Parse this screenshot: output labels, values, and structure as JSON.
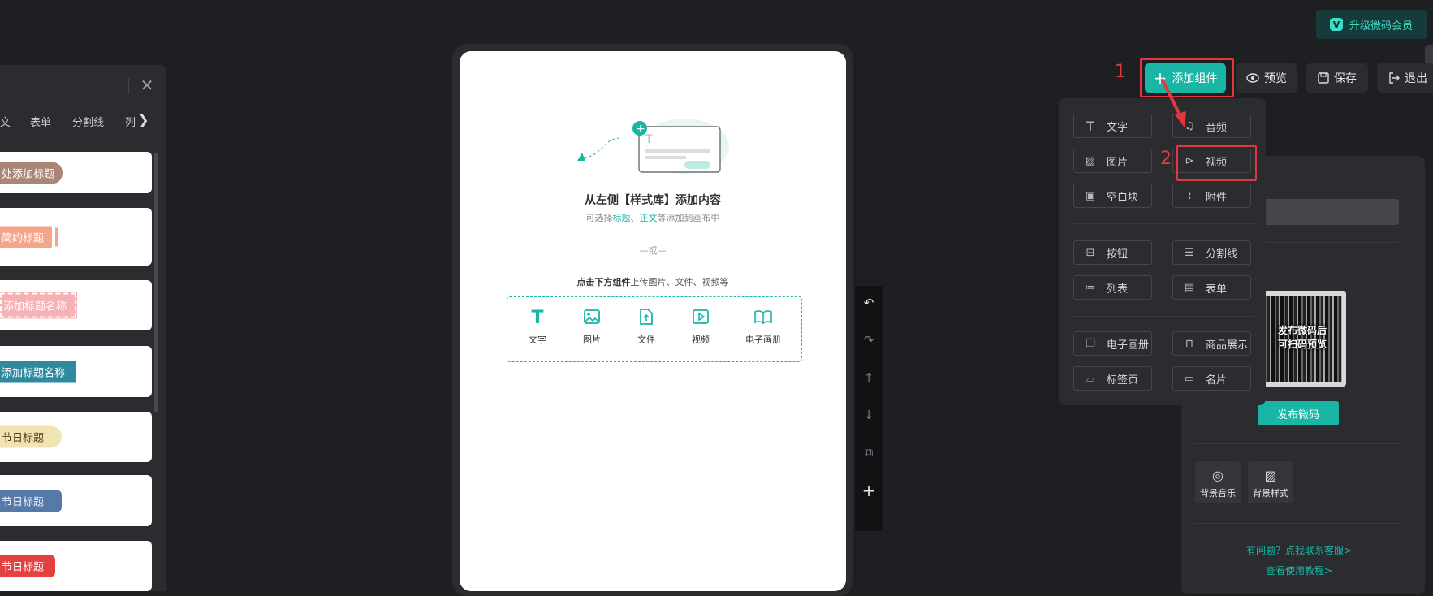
{
  "header": {
    "upgrade_label": "升级微码会员",
    "upgrade_badge": "V",
    "add_component_label": "添加组件",
    "preview_label": "预览",
    "save_label": "保存",
    "exit_label": "退出"
  },
  "annotations": {
    "step1": "1",
    "step2": "2",
    "accent_red": "#e0383e"
  },
  "style_library": {
    "tabs": [
      "文",
      "表单",
      "分割线",
      "列"
    ],
    "cards": [
      {
        "label": "处添加标题",
        "color": "#a98675"
      },
      {
        "label": "简约标题",
        "color": "#f5a58a"
      },
      {
        "label": "添加标题名称",
        "color": "#f6b1b5"
      },
      {
        "label": "添加标题名称",
        "color": "#2f8aa0"
      },
      {
        "label": "节日标题",
        "color": "#f1e4b3"
      },
      {
        "label": "节日标题",
        "color": "#5579a8"
      },
      {
        "label": "节日标题",
        "color": "#e34040"
      }
    ]
  },
  "canvas": {
    "title": "从左侧【样式库】添加内容",
    "subtitle_prefix": "可选择",
    "subtitle_hl1": "标题",
    "subtitle_sep": "、",
    "subtitle_hl2": "正文",
    "subtitle_suffix": "等添加到画布中",
    "or": "—或—",
    "hint_bold": "点击下方组件",
    "hint_rest": "上传图片、文件、视频等",
    "components": [
      {
        "label": "文字",
        "icon": "text-icon"
      },
      {
        "label": "图片",
        "icon": "image-icon"
      },
      {
        "label": "文件",
        "icon": "file-upload-icon"
      },
      {
        "label": "视频",
        "icon": "video-icon"
      },
      {
        "label": "电子画册",
        "icon": "book-icon"
      }
    ]
  },
  "dropdown": {
    "items": [
      {
        "label": "文字",
        "icon": "text-icon"
      },
      {
        "label": "音频",
        "icon": "music-icon"
      },
      {
        "label": "图片",
        "icon": "image-icon"
      },
      {
        "label": "视频",
        "icon": "video-icon"
      },
      {
        "label": "空白块",
        "icon": "blank-block-icon"
      },
      {
        "label": "附件",
        "icon": "paperclip-icon"
      },
      {
        "label": "按钮",
        "icon": "button-icon"
      },
      {
        "label": "分割线",
        "icon": "divider-icon"
      },
      {
        "label": "列表",
        "icon": "list-icon"
      },
      {
        "label": "表单",
        "icon": "form-icon"
      },
      {
        "label": "电子画册",
        "icon": "album-icon"
      },
      {
        "label": "商品展示",
        "icon": "shopping-bag-icon"
      },
      {
        "label": "标签页",
        "icon": "tabs-icon"
      },
      {
        "label": "名片",
        "icon": "card-icon"
      }
    ]
  },
  "right_panel": {
    "qr_text_line1": "发布微码后",
    "qr_text_line2": "可扫码预览",
    "publish_label": "发布微码",
    "bg_music_label": "背景音乐",
    "bg_style_label": "背景样式",
    "help_link": "有问题？点我联系客服>",
    "tutorial_link": "查看使用教程>"
  },
  "colors": {
    "accent": "#19b5a5",
    "bg": "#1e1f22",
    "panel": "#2b2c30"
  }
}
